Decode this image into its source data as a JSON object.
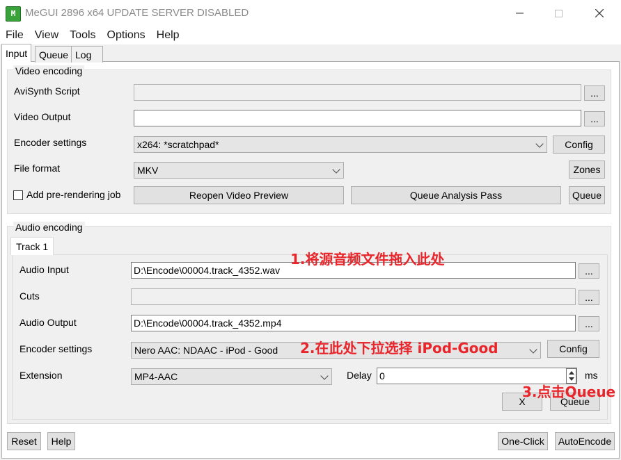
{
  "window": {
    "title": "MeGUI 2896 x64 UPDATE SERVER DISABLED",
    "app_icon_text": "M"
  },
  "menu": [
    "File",
    "View",
    "Tools",
    "Options",
    "Help"
  ],
  "tabs": {
    "input": "Input",
    "queue": "Queue",
    "log": "Log"
  },
  "video": {
    "group_title": "Video encoding",
    "avisynth_label": "AviSynth Script",
    "avisynth_value": "",
    "video_output_label": "Video Output",
    "video_output_value": "",
    "encoder_label": "Encoder settings",
    "encoder_value": "x264: *scratchpad*",
    "config_btn": "Config",
    "file_format_label": "File format",
    "file_format_value": "MKV",
    "zones_btn": "Zones",
    "prerender_label": "Add pre-rendering job",
    "reopen_btn": "Reopen Video Preview",
    "analysis_btn": "Queue Analysis Pass",
    "queue_btn": "Queue",
    "browse": "..."
  },
  "audio": {
    "group_title": "Audio encoding",
    "track_tab": "Track 1",
    "input_label": "Audio Input",
    "input_value": "D:\\Encode\\00004.track_4352.wav",
    "cuts_label": "Cuts",
    "cuts_value": "",
    "output_label": "Audio Output",
    "output_value": "D:\\Encode\\00004.track_4352.mp4",
    "encoder_label": "Encoder settings",
    "encoder_value": "Nero AAC: NDAAC - iPod - Good",
    "config_btn": "Config",
    "extension_label": "Extension",
    "extension_value": "MP4-AAC",
    "delay_label": "Delay",
    "delay_value": "0",
    "delay_unit": "ms",
    "x_btn": "X",
    "queue_btn": "Queue",
    "browse": "..."
  },
  "bottom": {
    "reset_btn": "Reset",
    "help_btn": "Help",
    "oneclick_btn": "One-Click",
    "autoencode_btn": "AutoEncode"
  },
  "annotations": {
    "step1": "1.将源音频文件拖入此处",
    "step2": "2.在此处下拉选择 iPod-Good",
    "step3": "3.点击Queue"
  },
  "colors": {
    "annotation": "#e8252a",
    "app_icon": "#3aa23a"
  }
}
